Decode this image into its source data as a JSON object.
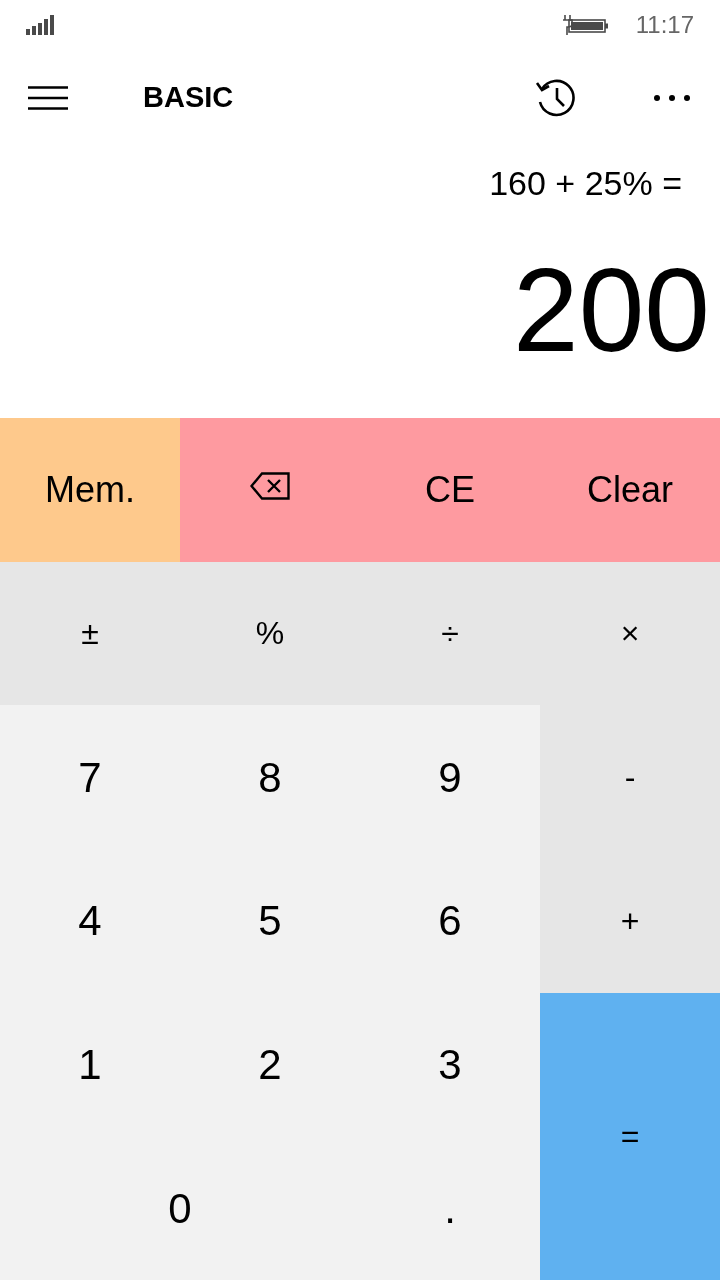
{
  "status_bar": {
    "time": "11:17"
  },
  "app_bar": {
    "title": "BASIC"
  },
  "display": {
    "expression": "160 + 25% =",
    "result": "200"
  },
  "keypad": [
    {
      "kind": "memory",
      "label": "Mem."
    },
    {
      "kind": "backspace"
    },
    {
      "kind": "clear",
      "label": "CE"
    },
    {
      "kind": "clear",
      "label": "Clear"
    },
    {
      "kind": "function",
      "label": "±"
    },
    {
      "kind": "function",
      "label": "%"
    },
    {
      "kind": "operator",
      "label": "÷"
    },
    {
      "kind": "operator",
      "label": "×"
    },
    {
      "kind": "digit",
      "label": "7"
    },
    {
      "kind": "digit",
      "label": "8"
    },
    {
      "kind": "digit",
      "label": "9"
    },
    {
      "kind": "operator",
      "label": "-"
    },
    {
      "kind": "digit",
      "label": "4"
    },
    {
      "kind": "digit",
      "label": "5"
    },
    {
      "kind": "digit",
      "label": "6"
    },
    {
      "kind": "operator",
      "label": "+"
    },
    {
      "kind": "digit",
      "label": "1"
    },
    {
      "kind": "digit",
      "label": "2"
    },
    {
      "kind": "digit",
      "label": "3"
    },
    {
      "kind": "equals",
      "label": "="
    },
    {
      "kind": "digit",
      "label": "0"
    },
    {
      "kind": "decimal",
      "label": "."
    }
  ]
}
